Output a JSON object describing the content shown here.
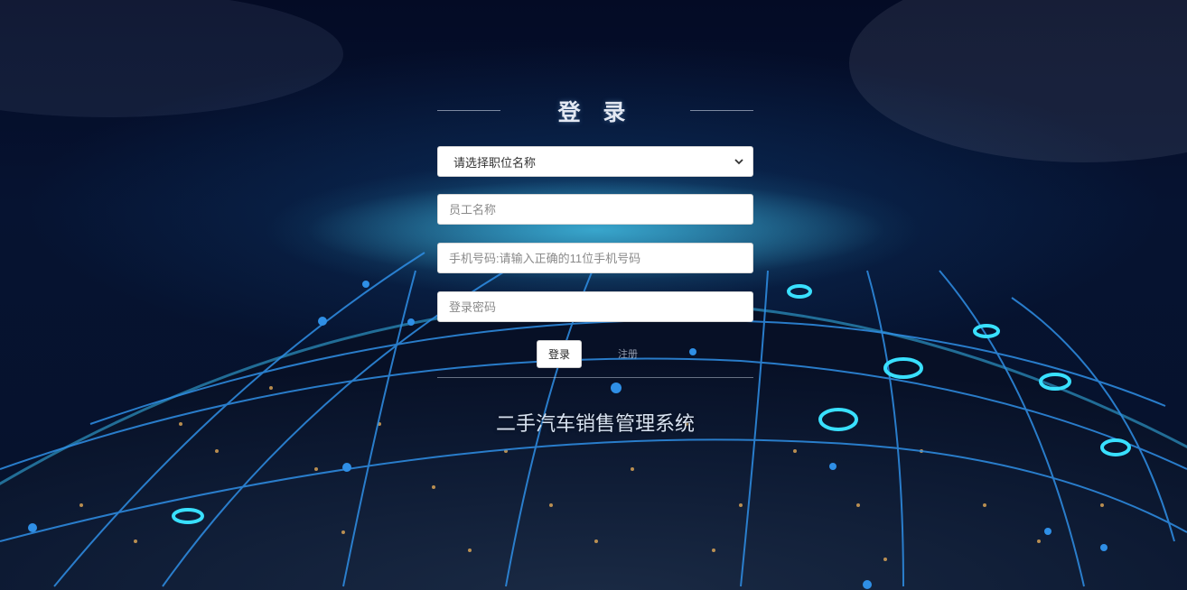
{
  "login": {
    "title": "登 录",
    "position_select": {
      "selected": "请选择职位名称"
    },
    "employee_name": {
      "placeholder": "员工名称"
    },
    "phone": {
      "placeholder": "手机号码:请输入正确的11位手机号码"
    },
    "password": {
      "placeholder": "登录密码"
    },
    "login_button": "登录",
    "register_link": "注册",
    "system_name": "二手汽车销售管理系统"
  },
  "colors": {
    "background_dark": "#040b25",
    "network_blue": "#2f8fe6",
    "glow_cyan": "#3cd2ff",
    "panel_text": "#e3e8f2"
  },
  "icons": {
    "select_arrow": "chevron-down-icon"
  }
}
